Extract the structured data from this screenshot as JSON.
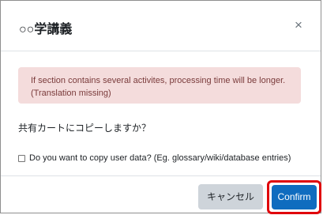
{
  "dialog": {
    "title": "○○学講義",
    "close_symbol": "×"
  },
  "alert": {
    "message": "If section contains several activites, processing time will be longer. (Translation missing)"
  },
  "question": "共有カートにコピーしますか？",
  "copy_user_data": {
    "label": "Do you want to copy user data? (Eg. glossary/wiki/database entries)",
    "checked": false
  },
  "buttons": {
    "cancel_label": "キャンセル",
    "confirm_label": "Confirm"
  },
  "colors": {
    "confirm_bg": "#0f6cbf",
    "cancel_bg": "#ced4da",
    "alert_bg": "#f4dcdc",
    "highlight": "#e0060b"
  }
}
